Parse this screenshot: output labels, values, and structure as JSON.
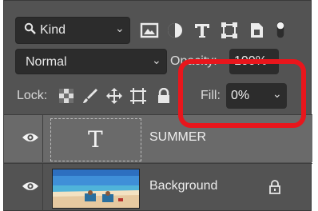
{
  "filter": {
    "kind_label": "Kind",
    "icons": [
      "image-filter-icon",
      "adjustment-filter-icon",
      "type-filter-icon",
      "shape-filter-icon",
      "smart-object-filter-icon",
      "filter-toggle-icon"
    ]
  },
  "blend": {
    "mode": "Normal",
    "opacity_label": "Opacity:",
    "opacity_value": "100%"
  },
  "lock": {
    "label": "Lock:",
    "icons": [
      "lock-transparent-pixels-icon",
      "lock-image-pixels-icon",
      "lock-position-icon",
      "lock-artboard-icon",
      "lock-all-icon"
    ]
  },
  "fill": {
    "label": "Fill:",
    "value": "0%"
  },
  "layers": [
    {
      "name": "SUMMER",
      "type": "text",
      "thumb_glyph": "T",
      "visible": true,
      "selected": true
    },
    {
      "name": "Background",
      "type": "image",
      "visible": true,
      "locked": true,
      "selected": false
    }
  ],
  "colors": {
    "panel_bg": "#535353",
    "field_bg": "#2c2c2c",
    "selected_row": "#6a6a6a",
    "highlight": "#e8161c"
  }
}
